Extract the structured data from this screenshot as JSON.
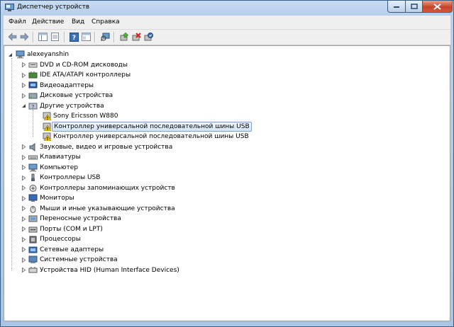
{
  "window": {
    "title": "Диспетчер устройств"
  },
  "menu": [
    "Файл",
    "Действие",
    "Вид",
    "Справка"
  ],
  "toolbar": [
    "back-icon",
    "forward-icon",
    "show-hide-tree-icon",
    "properties-icon",
    "help-icon",
    "console-icon",
    "scan-hardware-icon",
    "update-driver-icon",
    "uninstall-icon",
    "enable-device-icon"
  ],
  "tree": {
    "root": "alexeyanshin",
    "categories": [
      {
        "label": "DVD и CD-ROM дисководы",
        "icon": "dvd-drive-icon"
      },
      {
        "label": "IDE ATA/ATAPI контроллеры",
        "icon": "ide-controller-icon"
      },
      {
        "label": "Видеоадаптеры",
        "icon": "display-adapter-icon"
      },
      {
        "label": "Дисковые устройства",
        "icon": "disk-drive-icon"
      },
      {
        "label": "Другие устройства",
        "icon": "other-devices-icon",
        "expanded": true,
        "children": [
          {
            "label": "Sony Ericsson W880",
            "icon": "unknown-device-warning-icon"
          },
          {
            "label": "Контроллер универсальной последовательной шины USB",
            "icon": "unknown-device-warning-icon",
            "selected": true
          },
          {
            "label": "Контроллер универсальной последовательной шины USB",
            "icon": "unknown-device-warning-icon"
          }
        ]
      },
      {
        "label": "Звуковые, видео и игровые устройства",
        "icon": "sound-device-icon"
      },
      {
        "label": "Клавиатуры",
        "icon": "keyboard-icon"
      },
      {
        "label": "Компьютер",
        "icon": "computer-icon"
      },
      {
        "label": "Контроллеры USB",
        "icon": "usb-controller-icon"
      },
      {
        "label": "Контроллеры запоминающих устройств",
        "icon": "storage-controller-icon"
      },
      {
        "label": "Мониторы",
        "icon": "monitor-icon"
      },
      {
        "label": "Мыши и иные указывающие устройства",
        "icon": "mouse-icon"
      },
      {
        "label": "Переносные устройства",
        "icon": "portable-device-icon"
      },
      {
        "label": "Порты (COM и LPT)",
        "icon": "port-icon"
      },
      {
        "label": "Процессоры",
        "icon": "processor-icon"
      },
      {
        "label": "Сетевые адаптеры",
        "icon": "network-adapter-icon"
      },
      {
        "label": "Системные устройства",
        "icon": "system-device-icon"
      },
      {
        "label": "Устройства HID (Human Interface Devices)",
        "icon": "hid-device-icon"
      }
    ]
  }
}
